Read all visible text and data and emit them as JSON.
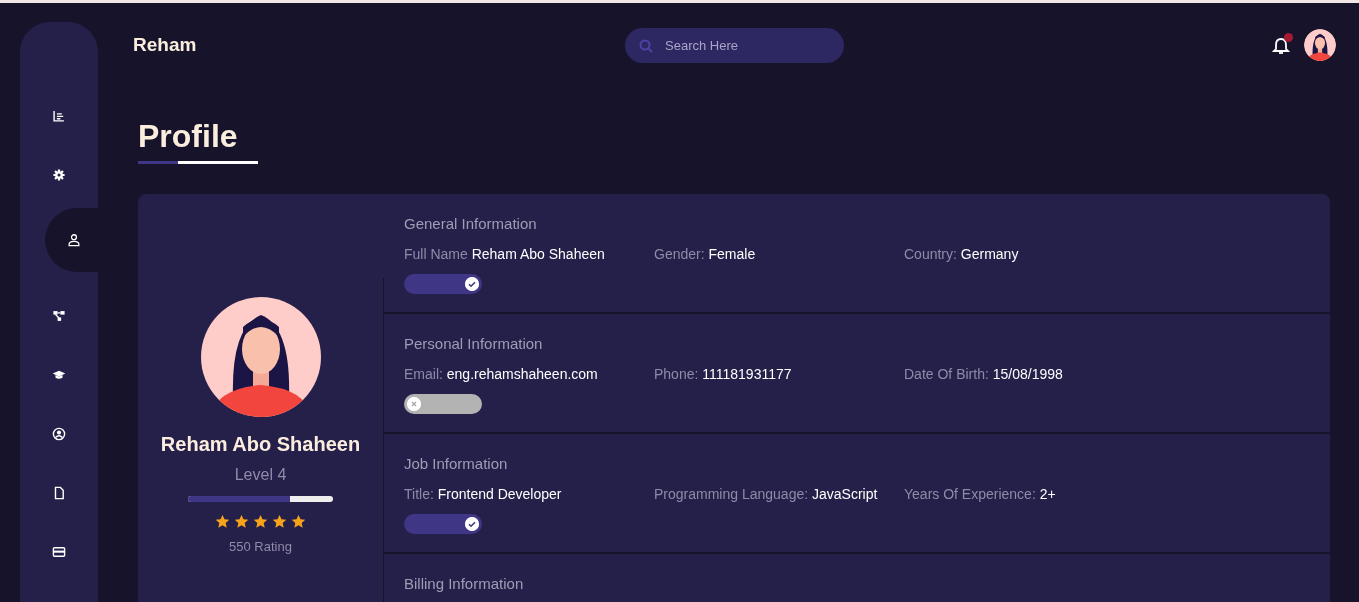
{
  "header": {
    "brand": "Reham",
    "search": {
      "placeholder": "Search Here"
    },
    "notifications": {
      "unread": true
    }
  },
  "sidebar": {
    "items": [
      {
        "selected": false
      },
      {
        "selected": false
      },
      {
        "selected": true
      },
      {
        "selected": false
      },
      {
        "selected": false
      },
      {
        "selected": false
      },
      {
        "selected": false
      },
      {
        "selected": false
      }
    ]
  },
  "page_title": "Profile",
  "profile": {
    "name": "Reham Abo Shaheen",
    "level_text": "Level 4",
    "level": 0.7,
    "stars": 5,
    "rating": "550 Rating"
  },
  "sections": [
    {
      "title": "General Information",
      "fields": [
        {
          "label": "Full Name",
          "value": "Reham Abo Shaheen"
        },
        {
          "label": "Gender:",
          "value": "Female"
        },
        {
          "label": "Country:",
          "value": "Germany"
        }
      ],
      "toggle": {
        "on": true
      }
    },
    {
      "title": "Personal Information",
      "fields": [
        {
          "label": "Email:",
          "value": "eng.rehamshaheen.com"
        },
        {
          "label": "Phone:",
          "value": "111181931177"
        },
        {
          "label": "Date Of Birth:",
          "value": "15/08/1998"
        }
      ],
      "toggle": {
        "on": false
      }
    },
    {
      "title": "Job Information",
      "fields": [
        {
          "label": "Title:",
          "value": "Frontend Developer"
        },
        {
          "label": "Programming Language:",
          "value": "JavaScript"
        },
        {
          "label": "Years Of Experience:",
          "value": "2+"
        }
      ],
      "toggle": {
        "on": true
      }
    },
    {
      "title": "Billing Information"
    }
  ]
}
